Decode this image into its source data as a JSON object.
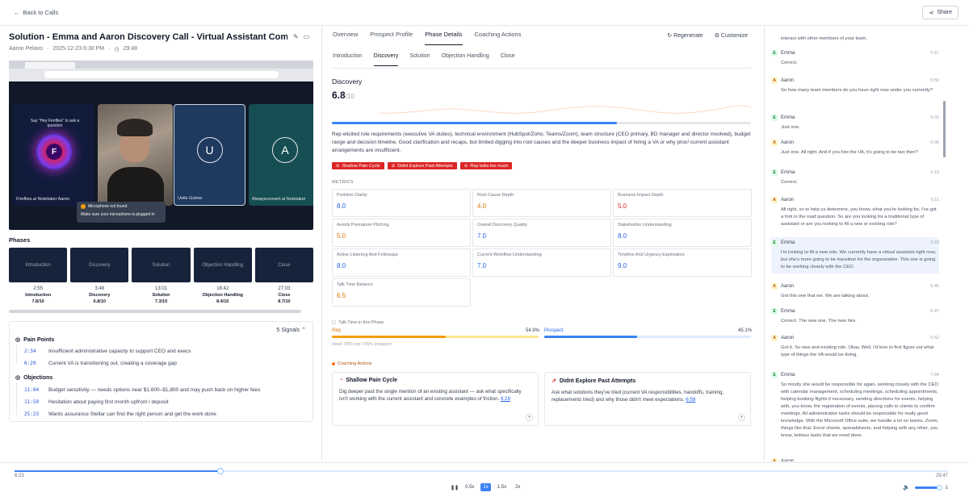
{
  "header": {
    "back_label": "Back to Calls",
    "share_label": "Share"
  },
  "call": {
    "title": "Solution - Emma and Aaron Discovery Call - Virtual Assistant Com...",
    "rep": "Aaron Pelavo",
    "datetime": "2025-12-23 6:30 PM",
    "duration": "29:48"
  },
  "video": {
    "tiles": [
      {
        "label": "Fireflies.ai Notetaker Aaron",
        "prompt": "Say \"Hey Fireflies\" to ask a question",
        "logo": "F"
      },
      {
        "label": ""
      },
      {
        "label": "Ueile Gulme",
        "initial": "U"
      },
      {
        "label": "Alwaysconvert.ai Notetaker",
        "initial": "A"
      }
    ],
    "toast_title": "Microphone not found",
    "toast_body": "Make sure your microphone is plugged in"
  },
  "phases": {
    "label": "Phases",
    "items": [
      {
        "name": "Introduction",
        "time": "2:55",
        "score": "7.8/10"
      },
      {
        "name": "Discovery",
        "time": "3:48",
        "score": "6.8/10"
      },
      {
        "name": "Solution",
        "time": "13:01",
        "score": "7.3/10"
      },
      {
        "name": "Objection Handling",
        "time": "18:42",
        "score": "8.4/10"
      },
      {
        "name": "Close",
        "time": "27:03",
        "score": "8.7/10"
      }
    ]
  },
  "signals": {
    "count": "5 Signals",
    "pain_label": "Pain Points",
    "pain": [
      {
        "time": "2:34",
        "text": "Insufficient administrative capacity to support CEO and execs"
      },
      {
        "time": "6:29",
        "text": "Current VA is transitioning out, creating a coverage gap"
      }
    ],
    "objection_label": "Objections",
    "objections": [
      {
        "time": "11:04",
        "text": "Budget sensitivity — needs options near $1,600–$1,800 and may push back on higher fees"
      },
      {
        "time": "11:59",
        "text": "Hesitation about paying first month upfront / deposit"
      },
      {
        "time": "25:23",
        "text": "Wants assurance Stellar can find the right person and get the work done"
      }
    ]
  },
  "main_tabs": [
    "Overview",
    "Prospect Profile",
    "Phase Details",
    "Coaching Actions"
  ],
  "main_tab_active": "Phase Details",
  "actions": {
    "regenerate": "Regenerate",
    "customize": "Customize"
  },
  "phase_tabs": [
    "Introduction",
    "Discovery",
    "Solution",
    "Objection Handling",
    "Close"
  ],
  "phase_detail": {
    "name": "Discovery",
    "score": "6.8",
    "score_max": "/10",
    "progress": 0.68,
    "summary": "Rep elicited role requirements (executive VA duties), technical environment (HubSpot/Zoho, Teams/Zoom), team structure (CEO primary, BD manager and director involved), budget range and decision timeline. Good clarification and recaps, but limited digging into root causes and the deeper business impact of hiring a VA or why prior/ current assistant arrangements are insufficient.",
    "tags": [
      "Shallow Pain Cycle",
      "Didnt Explore Past Attempts",
      "Rep talks too much"
    ],
    "metrics_label": "METRICS",
    "metrics": [
      {
        "name": "Problem Clarity",
        "value": "8.0",
        "color": "#2563eb"
      },
      {
        "name": "Root Cause Depth",
        "value": "4.0",
        "color": "#d97706"
      },
      {
        "name": "Business Impact Depth",
        "value": "5.0",
        "color": "#dc2626"
      },
      {
        "name": "Avoids Premature Pitching",
        "value": "5.0",
        "color": "#d97706"
      },
      {
        "name": "Overall Discovery Quality",
        "value": "7.0",
        "color": "#2563eb"
      },
      {
        "name": "Stakeholder Understanding",
        "value": "8.0",
        "color": "#2563eb"
      },
      {
        "name": "Active Listening And Followups",
        "value": "8.0",
        "color": "#2563eb"
      },
      {
        "name": "Current Workflow Understanding",
        "value": "7.0",
        "color": "#2563eb"
      },
      {
        "name": "Timeline And Urgency Exploration",
        "value": "9.0",
        "color": "#2563eb"
      },
      {
        "name": "Talk Time Balance",
        "value": "6.5",
        "color": "#d97706"
      }
    ],
    "talk_label": "Talk Time in this Phase",
    "rep_label": "Rep",
    "rep_pct": "54.9%",
    "rep_share": 0.549,
    "prospect_label": "Prospect",
    "prospect_pct": "45.1%",
    "prospect_share": 0.451,
    "ideal": "Ideal: 30% rep / 65% prospect",
    "coaching_label": "Coaching Actions",
    "coaching": [
      {
        "title": "Shallow Pain Cycle",
        "body": "Dig deeper past the single mention of an existing assistant — ask what specifically isn't working with the current assistant and concrete examples of friction.",
        "link": "6:29"
      },
      {
        "title": "Didnt Explore Past Attempts",
        "body": "Ask what solutions they've tried (current VA responsibilities, handoffs, training, replacements tried) and why those didn't meet expectations.",
        "link": "6:59"
      }
    ]
  },
  "transcript": [
    {
      "speaker": "",
      "initial": "",
      "time": "",
      "text": "interact with other members of your team."
    },
    {
      "speaker": "Emma",
      "initial": "E",
      "time": "5:57",
      "text": "Correct."
    },
    {
      "speaker": "Aaron",
      "initial": "A",
      "time": "5:59",
      "text": "So how many team members do you have right now under you currently?"
    },
    {
      "speaker": "Emma",
      "initial": "E",
      "time": "6:03",
      "text": "Just one."
    },
    {
      "speaker": "Aaron",
      "initial": "A",
      "time": "6:06",
      "text": "Just one. All right. And if you hire the VA, it's going to be two then?"
    },
    {
      "speaker": "Emma",
      "initial": "E",
      "time": "6:10",
      "text": "Correct."
    },
    {
      "speaker": "Aaron",
      "initial": "A",
      "time": "6:11",
      "text": "All right, so to help us determine, you know, what you're looking for, I've got a fork in the road question. So are you looking for a traditional type of assistant or are you looking to fill a new or existing role?"
    },
    {
      "speaker": "Emma",
      "initial": "E",
      "time": "6:23",
      "text": "I'm looking to fill a new role. We currently have a virtual assistant right now, but she's more going to be transition for the organization. This one is going to be working closely with the CEO."
    },
    {
      "speaker": "Aaron",
      "initial": "A",
      "time": "6:45",
      "text": "Got this one that we. We are talking about."
    },
    {
      "speaker": "Emma",
      "initial": "E",
      "time": "6:47",
      "text": "Correct. The new one. The new hire."
    },
    {
      "speaker": "Aaron",
      "initial": "A",
      "time": "6:52",
      "text": "Got it. So new and existing role. Okay. Well, I'd love to first figure out what type of things the VA would be doing."
    },
    {
      "speaker": "Emma",
      "initial": "E",
      "time": "7:04",
      "text": "So mostly she would be responsible for again, working closely with the CEO with calendar management, scheduling meetings, scheduling appointments, helping booking flights if necessary, sending directions for events, helping with, you know, the registration of events, placing calls to clients to confirm meetings. All administrative tasks should be responsible for really good knowledge. With the Microsoft Office suite, we handle a lot on teams. Zoom, things like that. Excel sheets, spreadsheets, and helping with any other, you know, tedious tasks that we need done."
    },
    {
      "speaker": "Aaron",
      "initial": "A",
      "time": "",
      "text": ""
    }
  ],
  "playback": {
    "current": "6:23",
    "duration": "29:47",
    "position": 0.221,
    "speeds": [
      "0.5x",
      "1x",
      "1.5x",
      "2x"
    ],
    "active_speed": "1x"
  }
}
